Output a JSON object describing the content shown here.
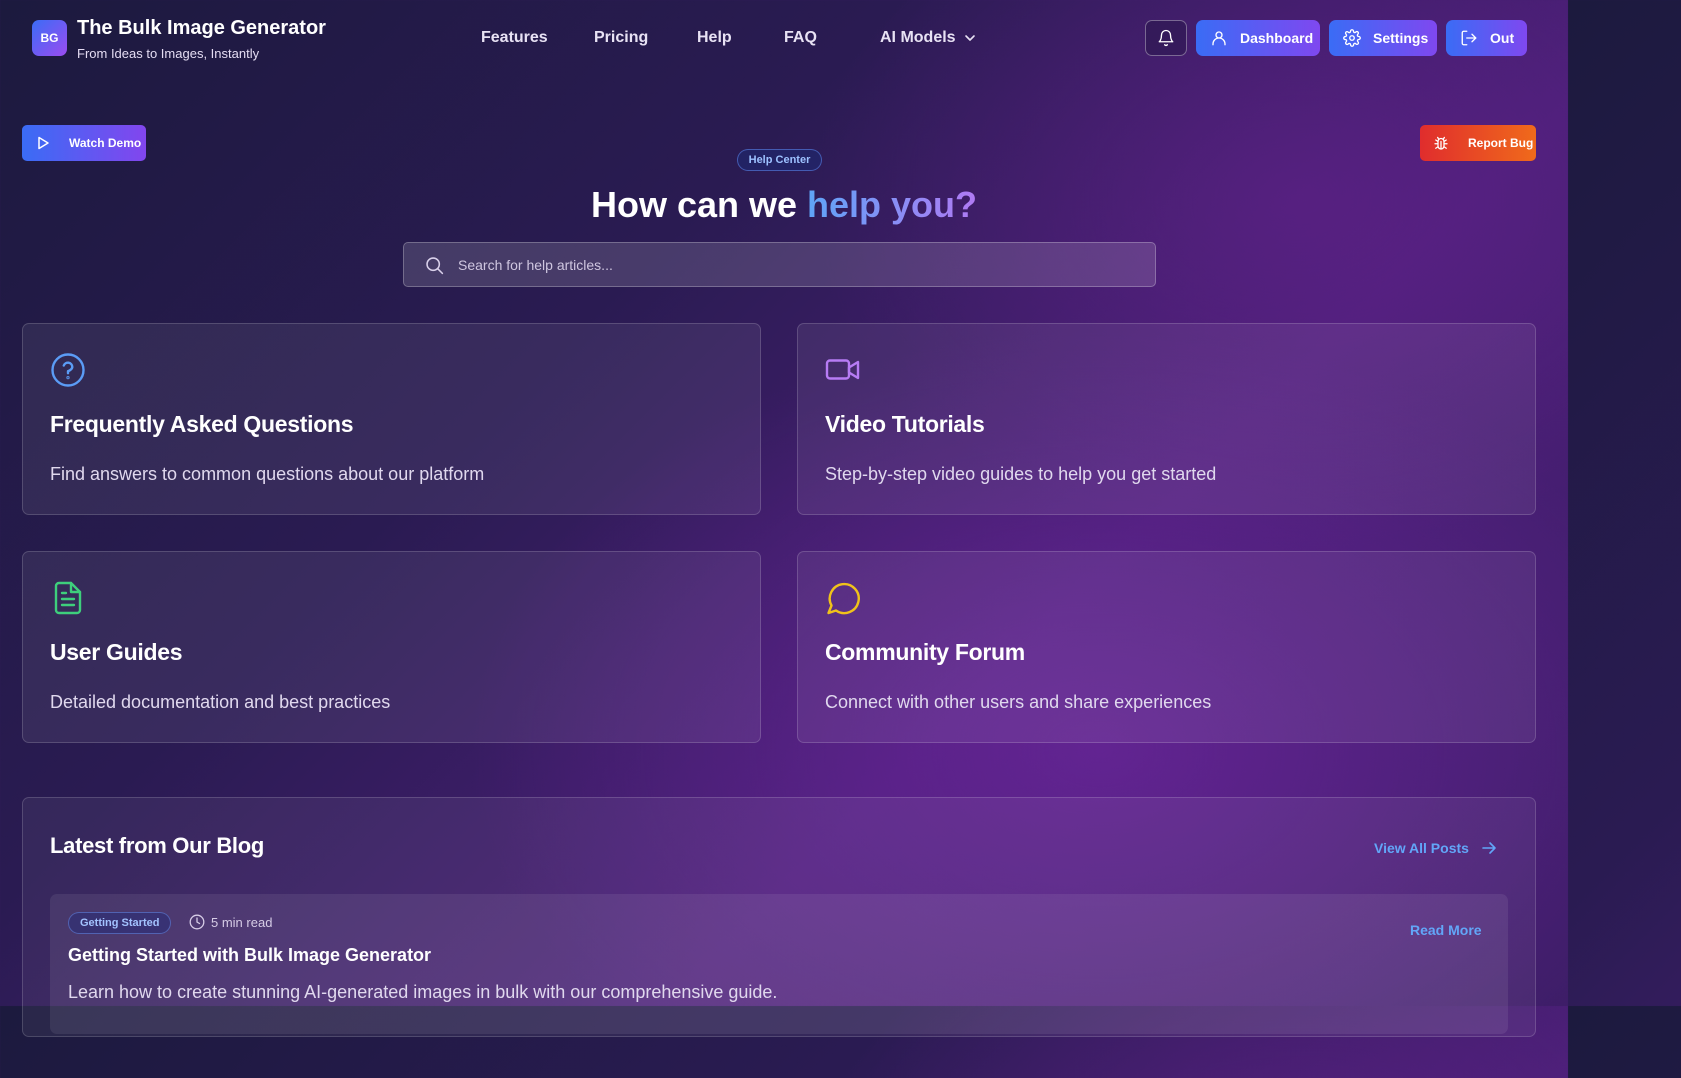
{
  "brand": {
    "badge": "BG",
    "title": "The Bulk Image Generator",
    "subtitle": "From Ideas to Images, Instantly"
  },
  "nav": {
    "features": "Features",
    "pricing": "Pricing",
    "help": "Help",
    "faq": "FAQ",
    "ai_models": "AI Models"
  },
  "header_buttons": {
    "dashboard": "Dashboard",
    "settings": "Settings",
    "logout": "Out"
  },
  "floating": {
    "watch_demo": "Watch Demo",
    "report_bug": "Report Bug"
  },
  "hero": {
    "pill": "Help Center",
    "title_plain": "How can we",
    "title_highlight": "help you?",
    "search_placeholder": "Search for help articles..."
  },
  "cards": [
    {
      "title": "Frequently Asked Questions",
      "description": "Find answers to common questions about our platform",
      "icon": "question-circle-icon",
      "color": "#5b9cf6"
    },
    {
      "title": "Video Tutorials",
      "description": "Step-by-step video guides to help you get started",
      "icon": "video-camera-icon",
      "color": "#b77cf5"
    },
    {
      "title": "User Guides",
      "description": "Detailed documentation and best practices",
      "icon": "document-icon",
      "color": "#3ecf7c"
    },
    {
      "title": "Community Forum",
      "description": "Connect with other users and share experiences",
      "icon": "chat-bubble-icon",
      "color": "#f0c21a"
    }
  ],
  "blog": {
    "title": "Latest from Our Blog",
    "view_all": "View All Posts",
    "posts": [
      {
        "tag": "Getting Started",
        "read_time": "5 min read",
        "title": "Getting Started with Bulk Image Generator",
        "description": "Learn how to create stunning AI-generated images in bulk with our comprehensive guide.",
        "read_more": "Read More"
      }
    ]
  },
  "colors": {
    "accent_blue": "#3a6cf5",
    "accent_purple": "#8246ee",
    "link_blue": "#62a6f8",
    "danger_red": "#e02d2d"
  }
}
